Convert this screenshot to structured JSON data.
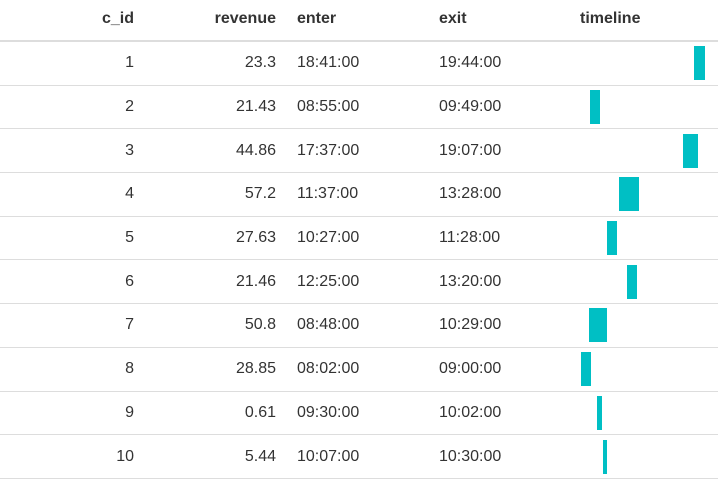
{
  "columns": {
    "c_id": "c_id",
    "revenue": "revenue",
    "enter": "enter",
    "exit": "exit",
    "timeline": "timeline"
  },
  "bar_color": "#00bfc4",
  "timeline_range": [
    "08:02:00",
    "19:44:00"
  ],
  "rows": [
    {
      "c_id": "1",
      "revenue": "23.3",
      "enter": "18:41:00",
      "exit": "19:44:00"
    },
    {
      "c_id": "2",
      "revenue": "21.43",
      "enter": "08:55:00",
      "exit": "09:49:00"
    },
    {
      "c_id": "3",
      "revenue": "44.86",
      "enter": "17:37:00",
      "exit": "19:07:00"
    },
    {
      "c_id": "4",
      "revenue": "57.2",
      "enter": "11:37:00",
      "exit": "13:28:00"
    },
    {
      "c_id": "5",
      "revenue": "27.63",
      "enter": "10:27:00",
      "exit": "11:28:00"
    },
    {
      "c_id": "6",
      "revenue": "21.46",
      "enter": "12:25:00",
      "exit": "13:20:00"
    },
    {
      "c_id": "7",
      "revenue": "50.8",
      "enter": "08:48:00",
      "exit": "10:29:00"
    },
    {
      "c_id": "8",
      "revenue": "28.85",
      "enter": "08:02:00",
      "exit": "09:00:00"
    },
    {
      "c_id": "9",
      "revenue": "0.61",
      "enter": "09:30:00",
      "exit": "10:02:00"
    },
    {
      "c_id": "10",
      "revenue": "5.44",
      "enter": "10:07:00",
      "exit": "10:30:00"
    }
  ]
}
